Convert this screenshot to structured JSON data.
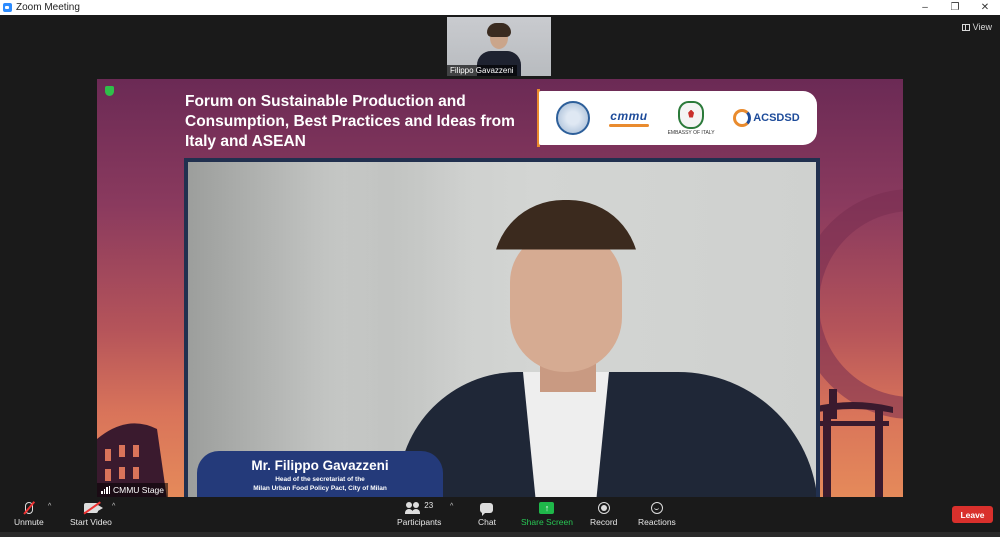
{
  "window": {
    "title": "Zoom Meeting",
    "controls": [
      "–",
      "❐",
      "✕"
    ]
  },
  "view_button": {
    "label": "View"
  },
  "thumbnail": {
    "name": "Filippo Gavazzeni"
  },
  "slide": {
    "title": "Forum on Sustainable Production and Consumption, Best Practices and Ideas from Italy and ASEAN",
    "logos": {
      "cmmu": "cmmu",
      "embassy_caption": "EMBASSY OF ITALY",
      "acsdsd": "ACSDSD"
    }
  },
  "speaker": {
    "name": "Mr. Filippo Gavazzeni",
    "role_line1": "Head of the secretariat of the",
    "role_line2": "Milan Urban Food Policy Pact, City of Milan"
  },
  "stage_tag": {
    "label": "CMMU Stage"
  },
  "toolbar": {
    "unmute": "Unmute",
    "start_video": "Start Video",
    "participants": "Participants",
    "participants_count": "23",
    "chat": "Chat",
    "share_screen": "Share Screen",
    "record": "Record",
    "reactions": "Reactions",
    "leave": "Leave",
    "caret": "^"
  },
  "colors": {
    "share_green": "#1fb84a",
    "leave_red": "#d9302c",
    "toolbar_bg": "#1a1a1a"
  }
}
